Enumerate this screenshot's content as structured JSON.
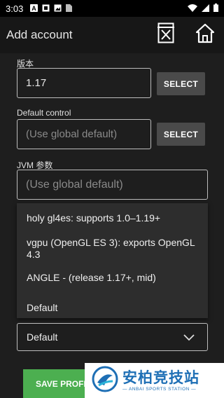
{
  "status_bar": {
    "time": "3:03",
    "icons": [
      "a-icon",
      "square-icon",
      "image-icon",
      "sim-icon",
      "wifi-icon",
      "signal-icon",
      "battery-icon"
    ]
  },
  "app_bar": {
    "title": "Add account",
    "actions": [
      "discard-icon",
      "home-icon"
    ]
  },
  "form": {
    "version": {
      "label": "版本",
      "value": "1.17",
      "button": "SELECT"
    },
    "default_control": {
      "label": "Default control",
      "placeholder": "(Use global default)",
      "button": "SELECT"
    },
    "jvm_args": {
      "label": "JVM 参数",
      "placeholder": "(Use global default)"
    }
  },
  "renderer_menu": {
    "items": [
      "holy gl4es: supports 1.0–1.19+",
      "vgpu (OpenGL ES 3): exports OpenGL 4.3",
      "ANGLE - (release 1.17+, mid)",
      "Default"
    ]
  },
  "renderer_select": {
    "value": "Default"
  },
  "save_button": {
    "label": "SAVE PROFILE"
  },
  "watermark": {
    "main": "安柏竞技站",
    "sub": "— ANBAI SPORTS STATION —"
  },
  "colors": {
    "accent_green": "#4caf50",
    "button_gray": "#4a4a4a",
    "watermark_blue": "#1e6fb5"
  }
}
